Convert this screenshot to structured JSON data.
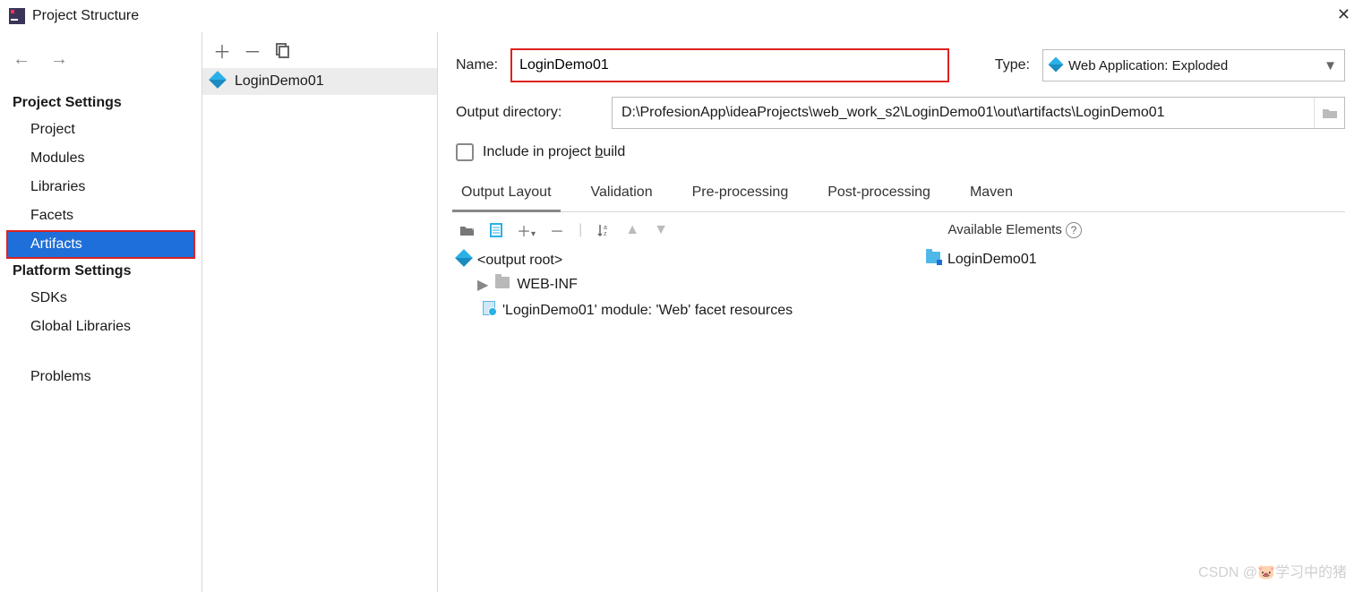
{
  "window": {
    "title": "Project Structure"
  },
  "sidebar": {
    "sections": [
      {
        "title": "Project Settings",
        "items": [
          "Project",
          "Modules",
          "Libraries",
          "Facets",
          "Artifacts"
        ]
      },
      {
        "title": "Platform Settings",
        "items": [
          "SDKs",
          "Global Libraries"
        ]
      }
    ],
    "standalone": "Problems",
    "selected": "Artifacts"
  },
  "artifacts_list": {
    "items": [
      "LoginDemo01"
    ]
  },
  "detail": {
    "name_label": "Name:",
    "name_value": "LoginDemo01",
    "type_label": "Type:",
    "type_value": "Web Application: Exploded",
    "outdir_label": "Output directory:",
    "outdir_value": "D:\\ProfesionApp\\ideaProjects\\web_work_s2\\LoginDemo01\\out\\artifacts\\LoginDemo01",
    "include_build_prefix": "Include in project ",
    "include_build_mnemonic": "b",
    "include_build_suffix": "uild",
    "tabs": [
      "Output Layout",
      "Validation",
      "Pre-processing",
      "Post-processing",
      "Maven"
    ],
    "available_label": "Available Elements",
    "tree_left": {
      "root": "<output root>",
      "webinf": "WEB-INF",
      "facet": "'LoginDemo01' module: 'Web' facet resources"
    },
    "tree_right": {
      "module": "LoginDemo01"
    }
  },
  "watermark": "CSDN @🐷学习中的猪"
}
